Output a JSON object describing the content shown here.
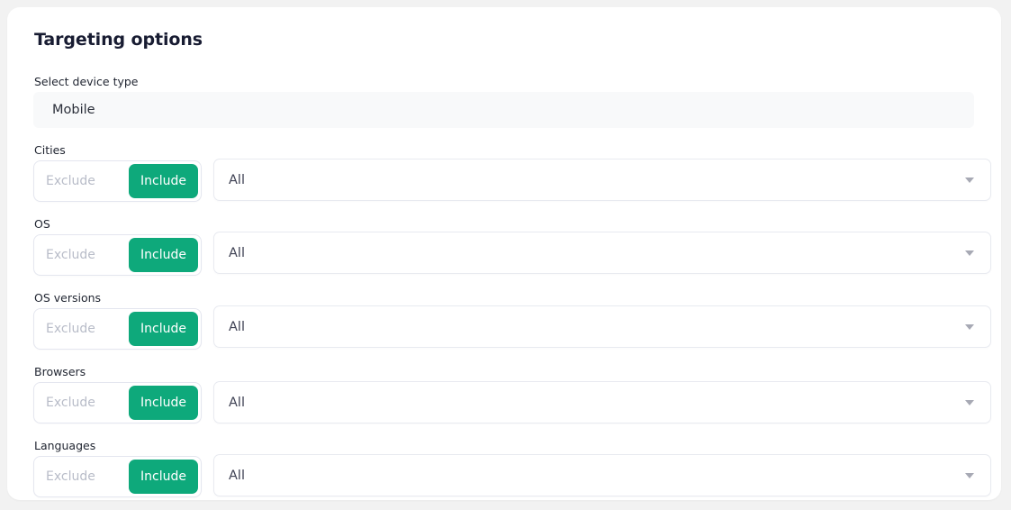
{
  "card": {
    "title": "Targeting options",
    "device_type": {
      "label": "Select device type",
      "value": "Mobile"
    },
    "toggle": {
      "exclude_label": "Exclude",
      "include_label": "Include",
      "active": "Include"
    },
    "select_value": "All",
    "caret_icon": "chevron-down-icon",
    "rows": [
      {
        "id": "cities",
        "label": "Cities",
        "exclude_label": "Exclude",
        "include_label": "Include",
        "selected": "All"
      },
      {
        "id": "os",
        "label": "OS",
        "exclude_label": "Exclude",
        "include_label": "Include",
        "selected": "All"
      },
      {
        "id": "os-versions",
        "label": "OS versions",
        "exclude_label": "Exclude",
        "include_label": "Include",
        "selected": "All"
      },
      {
        "id": "browsers",
        "label": "Browsers",
        "exclude_label": "Exclude",
        "include_label": "Include",
        "selected": "All"
      },
      {
        "id": "languages",
        "label": "Languages",
        "exclude_label": "Exclude",
        "include_label": "Include",
        "selected": "All"
      }
    ]
  },
  "colors": {
    "accent_green": "#0ea97b",
    "page_background": "#f2f2f2",
    "card_background": "#ffffff",
    "device_box_background": "#f8f9fa",
    "title_text": "#181c32",
    "placeholder_text": "#b8bcc8",
    "border": "#e4e6ef",
    "caret": "#a7a9b4"
  }
}
